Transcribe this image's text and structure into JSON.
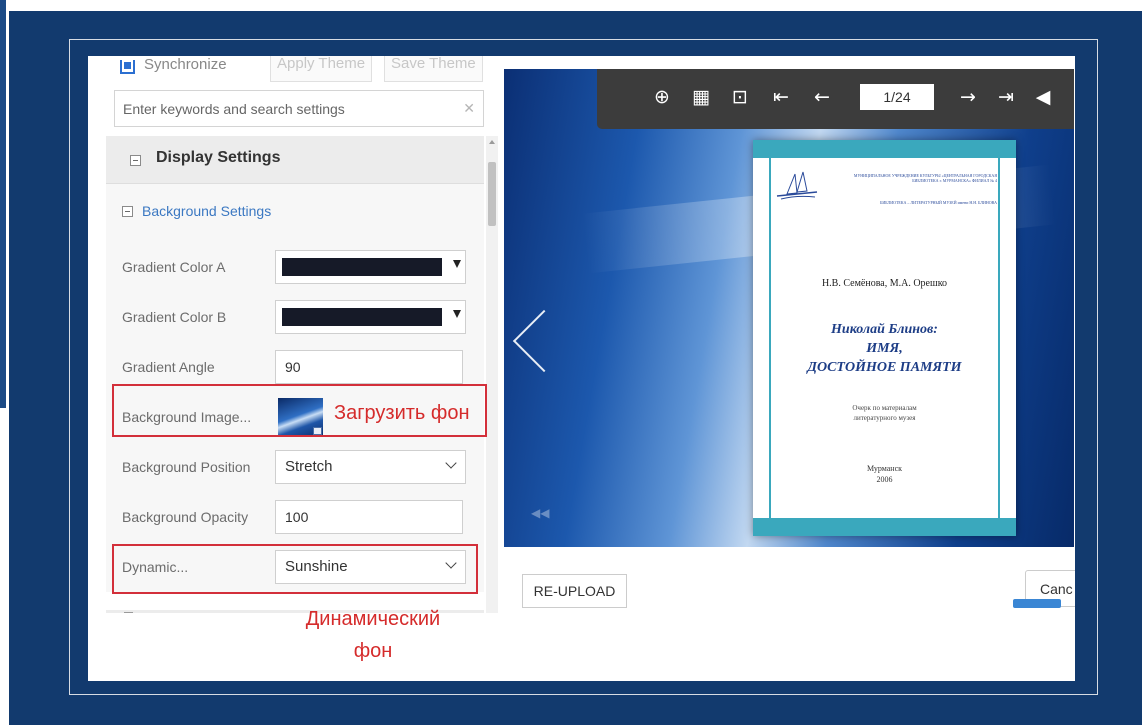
{
  "settings": {
    "sync_label": "Synchronize",
    "apply_theme": "Apply Theme",
    "save_theme": "Save Theme",
    "search_placeholder": "Enter keywords and search settings",
    "section_title": "Display Settings",
    "subsection_title": "Background Settings",
    "gradient_color_a": {
      "label": "Gradient Color A",
      "color": "#161a28"
    },
    "gradient_color_b": {
      "label": "Gradient Color B",
      "color": "#161a28"
    },
    "gradient_angle": {
      "label": "Gradient Angle",
      "value": "90"
    },
    "background_image": {
      "label": "Background Image..."
    },
    "background_position": {
      "label": "Background Position",
      "value": "Stretch"
    },
    "background_opacity": {
      "label": "Background Opacity",
      "value": "100"
    },
    "dynamic": {
      "label": "Dynamic...",
      "value": "Sunshine"
    }
  },
  "annotations": {
    "upload_background": "Загрузить фон",
    "dynamic_background": [
      "Динамический",
      "фон"
    ]
  },
  "toolbar": {
    "icons": [
      "zoom-in-icon",
      "thumbnails-icon",
      "play-icon",
      "first-page-icon",
      "previous-page-icon",
      "next-page-icon",
      "last-page-icon",
      "sound-icon"
    ],
    "page": "1/24"
  },
  "book": {
    "header": "МУНИЦИПАЛЬНОЕ УЧРЕЖДЕНИЕ КУЛЬТУРЫ «ЦЕНТРАЛЬНАЯ ГОРОДСКАЯ БИБЛИОТЕКА г. МУРМАНСКА» ФИЛИАЛ № 4",
    "library": "БИБЛИОТЕКА – ЛИТЕРАТУРНЫЙ МУЗЕЙ имени Н.Н. БЛИНОВА",
    "authors": "Н.В. Семёнова,  М.А. Орешко",
    "title_line1": "Николай  Блинов:",
    "title_line2": "ИМЯ,",
    "title_line3": "ДОСТОЙНОЕ ПАМЯТИ",
    "subtitle_line1": "Очерк по материалам",
    "subtitle_line2": "литературного музея",
    "city": "Мурманск",
    "year": "2006"
  },
  "buttons": {
    "reupload": "RE-UPLOAD",
    "cancel": "Canc"
  },
  "colors": {
    "slide_background": "#123a6e",
    "highlight_red": "#d32f3a",
    "book_accent": "#3aa8bd",
    "link_blue": "#3b78c2"
  }
}
